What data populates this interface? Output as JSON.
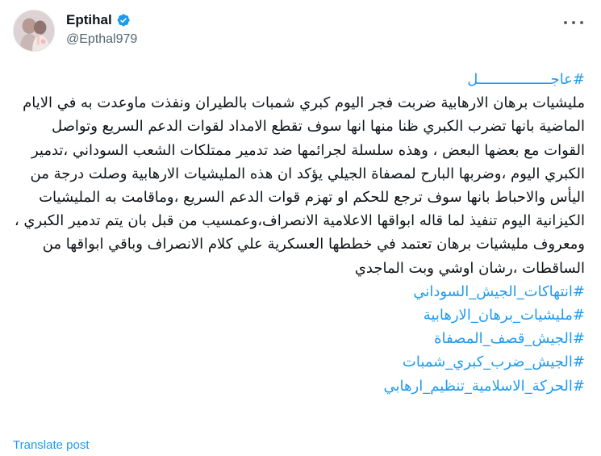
{
  "author": {
    "display_name": "Eptihal",
    "handle": "@Epthal979",
    "verified": true,
    "avatar_icon": "profile-photo",
    "verified_icon": "verified-badge-icon",
    "verified_color": "#1d9bf0"
  },
  "menu": {
    "icon": "more-horizontal-icon"
  },
  "post": {
    "lead_hashtag": "#عاجـــــــــــــــــل",
    "text": "مليشيات برهان الارهابية ضربت فجر اليوم كبري شمبات بالطيران ونفذت ماوعدت به في الايام الماضية بانها تضرب الكبري ظنا منها انها سوف تقطع الامداد لقوات الدعم السريع وتواصل القوات مع بعضها البعض ، وهذه سلسلة لجرائمها ضد تدمير ممتلكات الشعب السوداني ،تدمير الكبري اليوم ،وضربها البارح لمصفاة الجيلي يؤكد ان هذه المليشيات الارهابية وصلت درجة من اليأس والاحباط بانها سوف ترجع للحكم او تهزم قوات الدعم السريع ،وماقامت به المليشيات الكيزانية اليوم تنفيذ لما قاله ابواقها الاعلامية الانصراف،وعمسيب من قبل بان يتم تدمير الكبري ، ومعروف مليشيات برهان تعتمد في خططها العسكرية علي كلام الانصراف وباقي ابواقها من الساقطات ،رشان اوشي وبت الماجدي",
    "hashtags": [
      "#انتهاكات_الجيش_السوداني",
      "#مليشيات_برهان_الارهابية",
      "#الجيش_قصف_المصفاة",
      "#الجيش_ضرب_كبري_شمبات",
      "#الحركة_الاسلامية_تنظيم_ارهابي"
    ],
    "hashtag_color": "#1d9bf0"
  },
  "footer": {
    "translate_label": "Translate post"
  }
}
